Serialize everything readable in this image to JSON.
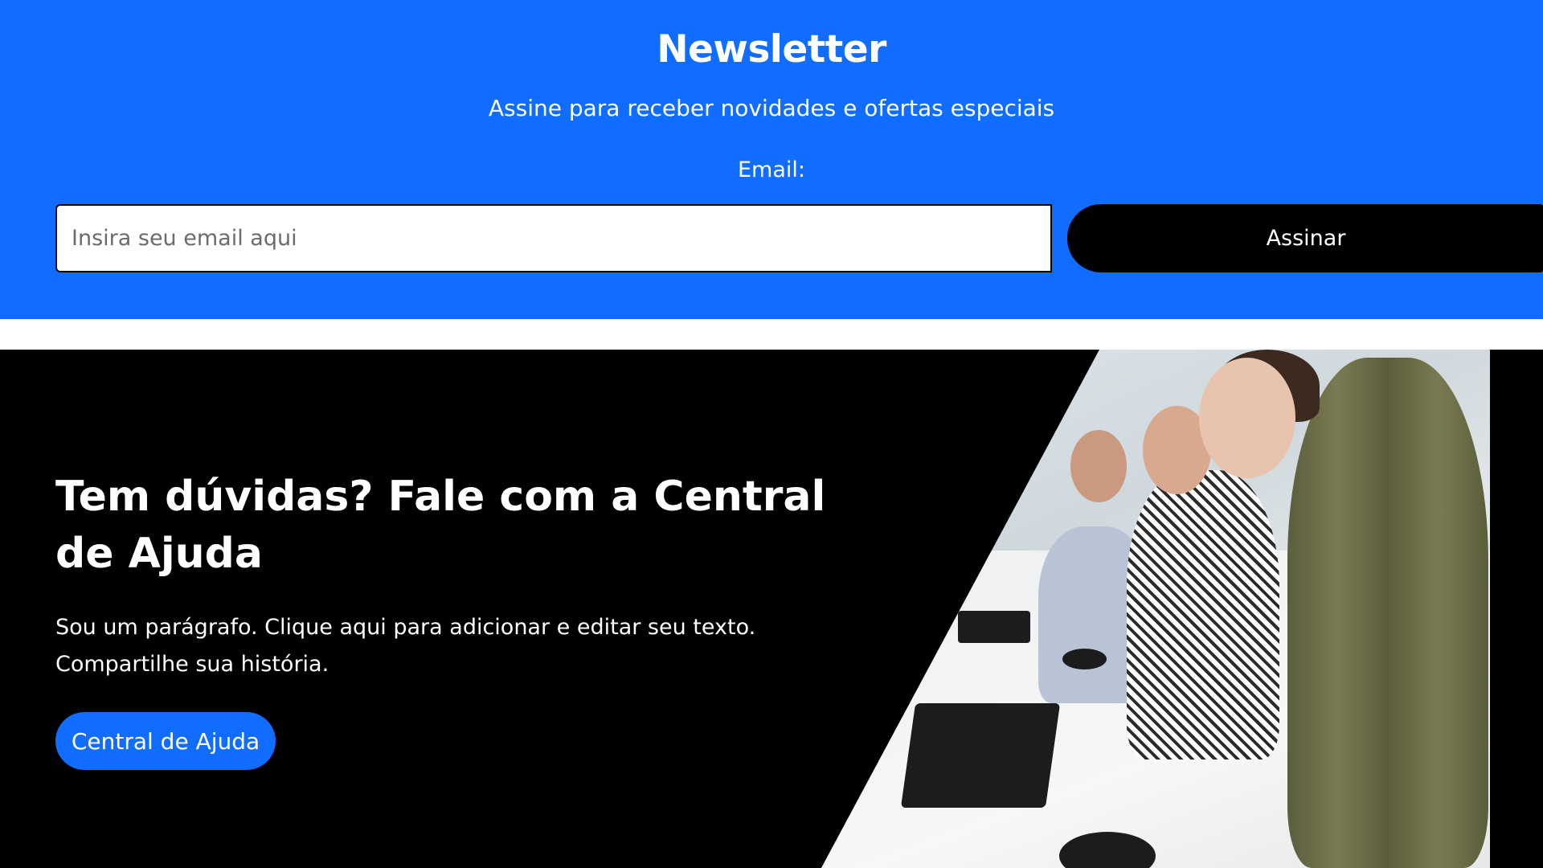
{
  "newsletter": {
    "title": "Newsletter",
    "subtitle": "Assine para receber novidades e ofertas especiais",
    "email_label": "Email:",
    "email_placeholder": "Insira seu email aqui",
    "email_value": "",
    "submit_label": "Assinar",
    "background_color": "#116dff"
  },
  "help": {
    "title": "Tem dúvidas? Fale com a Central de Ajuda",
    "paragraph": "Sou um parágrafo. Clique aqui para adicionar e editar seu texto. Compartilhe sua história.",
    "button_label": "Central de Ajuda",
    "background_color": "#000000",
    "accent_color": "#116dff"
  }
}
